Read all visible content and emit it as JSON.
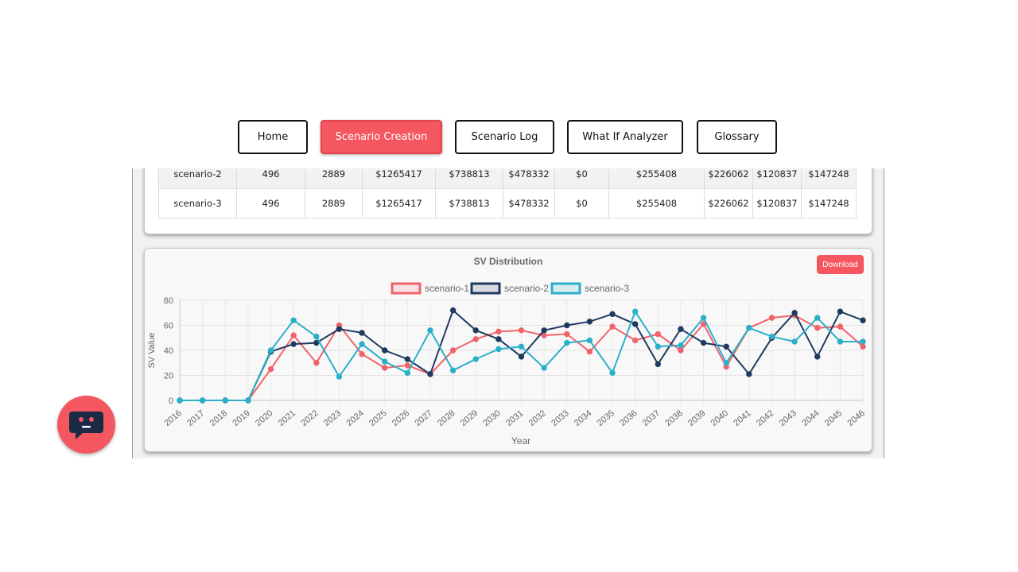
{
  "nav": {
    "items": [
      {
        "label": "Home"
      },
      {
        "label": "Scenario Creation"
      },
      {
        "label": "Scenario Log"
      },
      {
        "label": "What If Analyzer"
      },
      {
        "label": "Glossary"
      }
    ],
    "active_index": 1
  },
  "table": {
    "rows": [
      [
        "scenario-2",
        "496",
        "2889",
        "$1265417",
        "$738813",
        "$478332",
        "$0",
        "$255408",
        "$226062",
        "$120837",
        "$147248"
      ],
      [
        "scenario-3",
        "496",
        "2889",
        "$1265417",
        "$738813",
        "$478332",
        "$0",
        "$255408",
        "$226062",
        "$120837",
        "$147248"
      ]
    ]
  },
  "download_label": "Download",
  "colors": {
    "accent": "#f4575f",
    "scenario_1": "#f0636b",
    "scenario_2": "#1f3a60",
    "scenario_3": "#2bb0c9"
  },
  "icons": {
    "chat_fab": "chat-bubble-icon"
  },
  "chart_data": {
    "type": "line",
    "title": "SV Distribution",
    "xlabel": "Year",
    "ylabel": "SV Value",
    "ylim": [
      0,
      80
    ],
    "yticks": [
      0,
      20,
      40,
      60,
      80
    ],
    "grid": true,
    "legend_position": "top",
    "categories": [
      "2016",
      "2017",
      "2018",
      "2019",
      "2020",
      "2021",
      "2022",
      "2023",
      "2024",
      "2025",
      "2026",
      "2027",
      "2028",
      "2029",
      "2030",
      "2031",
      "2032",
      "2033",
      "2034",
      "2035",
      "2036",
      "2037",
      "2038",
      "2039",
      "2040",
      "2041",
      "2042",
      "2043",
      "2044",
      "2045",
      "2046"
    ],
    "series": [
      {
        "name": "scenario-1",
        "values": [
          0,
          0,
          0,
          0,
          25,
          52,
          30,
          60,
          37,
          26,
          28,
          21,
          40,
          49,
          55,
          56,
          52,
          53,
          39,
          59,
          48,
          53,
          40,
          61,
          27,
          58,
          66,
          68,
          58,
          59,
          43
        ]
      },
      {
        "name": "scenario-2",
        "values": [
          0,
          0,
          0,
          0,
          39,
          45,
          46,
          57,
          54,
          40,
          33,
          21,
          72,
          56,
          49,
          35,
          56,
          60,
          63,
          69,
          61,
          29,
          57,
          46,
          43,
          21,
          50,
          70,
          35,
          71,
          64
        ]
      },
      {
        "name": "scenario-3",
        "values": [
          0,
          0,
          0,
          0,
          40,
          64,
          51,
          19,
          45,
          31,
          22,
          56,
          24,
          33,
          41,
          43,
          26,
          46,
          48,
          22,
          71,
          43,
          44,
          66,
          30,
          58,
          51,
          47,
          66,
          47,
          47
        ]
      }
    ]
  }
}
